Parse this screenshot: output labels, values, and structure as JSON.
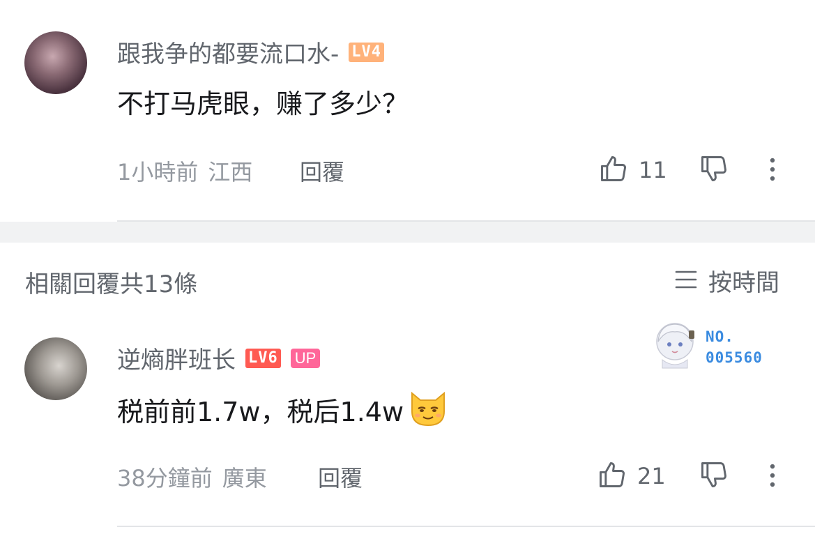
{
  "comment": {
    "username": "跟我争的都要流口水-",
    "level": "LV4",
    "text": "不打马虎眼，赚了多少？",
    "time": "1小時前",
    "location": "江西",
    "reply_label": "回覆",
    "likes": "11"
  },
  "replies_header": {
    "title": "相關回覆共13條",
    "sort_label": "按時間"
  },
  "reply": {
    "username": "逆熵胖班长",
    "level": "LV6",
    "up_badge": "UP",
    "text": "税前前1.7w，税后1.4w",
    "time": "38分鐘前",
    "location": "廣東",
    "reply_label": "回覆",
    "likes": "21",
    "fan_badge": {
      "line1": "NO.",
      "line2": "005560"
    }
  },
  "colors": {
    "lv4": "#ffb27a",
    "lv6": "#ff5a52",
    "up": "#ff6699",
    "fan_number": "#3a8be0"
  }
}
